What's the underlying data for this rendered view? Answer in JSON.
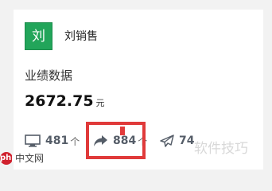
{
  "user": {
    "avatar_char": "刘",
    "name": "刘销售"
  },
  "metric": {
    "title": "业绩数据",
    "value": "2672.75",
    "unit": "元"
  },
  "stats": [
    {
      "icon": "monitor-icon",
      "count": "481",
      "unit": "个"
    },
    {
      "icon": "share-icon",
      "count": "884",
      "unit": "个"
    },
    {
      "icon": "paper-plane-icon",
      "count": "74",
      "unit": ""
    }
  ],
  "watermark": {
    "logo_text": "php",
    "left_text": "中文网",
    "right_text": "软件技巧"
  },
  "colors": {
    "avatar_bg": "#22a55a",
    "highlight": "#e03a3a"
  }
}
